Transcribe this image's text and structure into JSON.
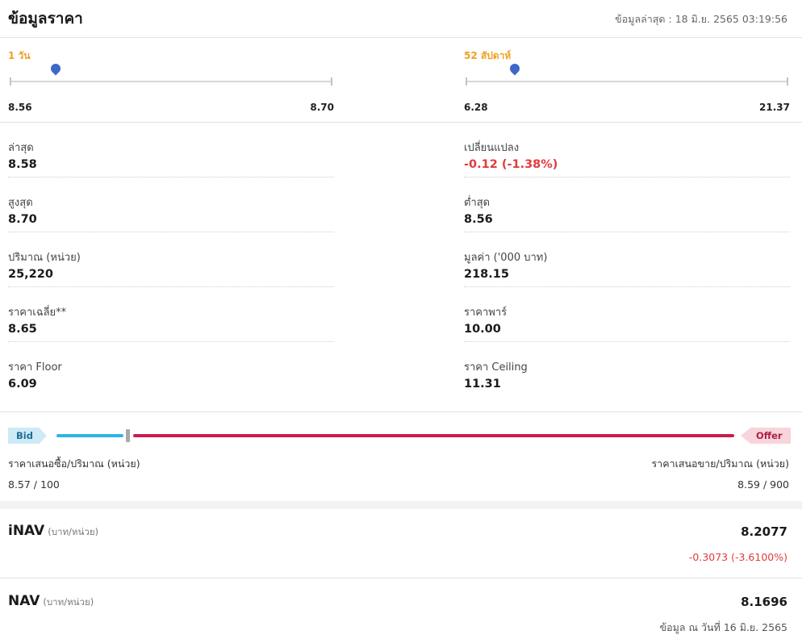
{
  "header": {
    "title": "ข้อมูลราคา",
    "last_updated": "ข้อมูลล่าสุด : 18 มิ.ย. 2565 03:19:56"
  },
  "ranges": {
    "day": {
      "label": "1 วัน",
      "low": "8.56",
      "high": "8.70",
      "current": 8.58,
      "low_value": 8.56,
      "high_value": 8.7
    },
    "week52": {
      "label": "52 สัปดาห์",
      "low": "6.28",
      "high": "21.37",
      "current": 8.58,
      "low_value": 6.28,
      "high_value": 21.37
    }
  },
  "stats": {
    "last": {
      "label": "ล่าสุด",
      "value": "8.58"
    },
    "change": {
      "label": "เปลี่ยนแปลง",
      "value": "-0.12 (-1.38%)"
    },
    "high": {
      "label": "สูงสุด",
      "value": "8.70"
    },
    "low": {
      "label": "ต่ำสุด",
      "value": "8.56"
    },
    "volume": {
      "label": "ปริมาณ (หน่วย)",
      "value": "25,220"
    },
    "turnover": {
      "label": "มูลค่า ('000 บาท)",
      "value": "218.15"
    },
    "average": {
      "label": "ราคาเฉลี่ย**",
      "value": "8.65"
    },
    "par": {
      "label": "ราคาพาร์",
      "value": "10.00"
    },
    "floor": {
      "label": "ราคา Floor",
      "value": "6.09"
    },
    "ceiling": {
      "label": "ราคา Ceiling",
      "value": "11.31"
    }
  },
  "bid_offer": {
    "bid_tag": "Bid",
    "offer_tag": "Offer",
    "bid_label": "ราคาเสนอซื้อ/ปริมาณ (หน่วย)",
    "offer_label": "ราคาเสนอขาย/ปริมาณ (หน่วย)",
    "bid_value": "8.57 / 100",
    "offer_value": "8.59 / 900",
    "bid_volume": 100,
    "offer_volume": 900
  },
  "inav": {
    "title": "iNAV",
    "unit": "(บาท/หน่วย)",
    "value": "8.2077",
    "change": "-0.3073 (-3.6100%)"
  },
  "nav": {
    "title": "NAV",
    "unit": "(บาท/หน่วย)",
    "value": "8.1696",
    "date": "ข้อมูล ณ วันที่ 16 มิ.ย. 2565"
  },
  "colors": {
    "range_label": "#f0a020",
    "marker": "#3d68c8",
    "negative": "#e23b3b",
    "bid_bar": "#2db5e8",
    "offer_bar": "#c81d4e"
  }
}
